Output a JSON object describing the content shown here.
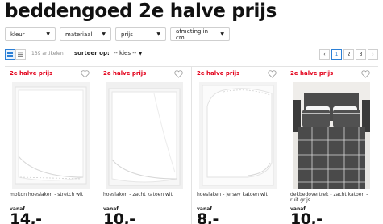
{
  "page_title": "beddengoed 2e halve prijs",
  "filters": [
    {
      "label": "kleur"
    },
    {
      "label": "materiaal"
    },
    {
      "label": "prijs"
    },
    {
      "label": "afmeting in cm"
    }
  ],
  "toolbar": {
    "article_count": "139 artikelen",
    "sort_label": "sorteer op:",
    "sort_value": "-- kies --"
  },
  "pagination": {
    "prev": "‹",
    "pages": [
      "1",
      "2",
      "3"
    ],
    "current": "1",
    "next": "›"
  },
  "products": [
    {
      "badge": "2e halve prijs",
      "name": "molton hoeslaken - stretch wit",
      "vanaf": "vanaf",
      "price": "14,-",
      "image": "white-fitted-sheet"
    },
    {
      "badge": "2e halve prijs",
      "name": "hoeslaken - zacht katoen wit",
      "vanaf": "vanaf",
      "price": "10,-",
      "image": "white-fitted-sheet"
    },
    {
      "badge": "2e halve prijs",
      "name": "hoeslaken - jersey katoen wit",
      "vanaf": "vanaf",
      "price": "8,-",
      "image": "white-fitted-sheet"
    },
    {
      "badge": "2e halve prijs",
      "name": "dekbedovertrek - zacht katoen - ruit grijs",
      "vanaf": "vanaf",
      "price": "10,-",
      "image": "grey-check-duvet-on-bed"
    }
  ],
  "colors": {
    "badge": "#e2001a",
    "accent": "#2b7fd6"
  }
}
